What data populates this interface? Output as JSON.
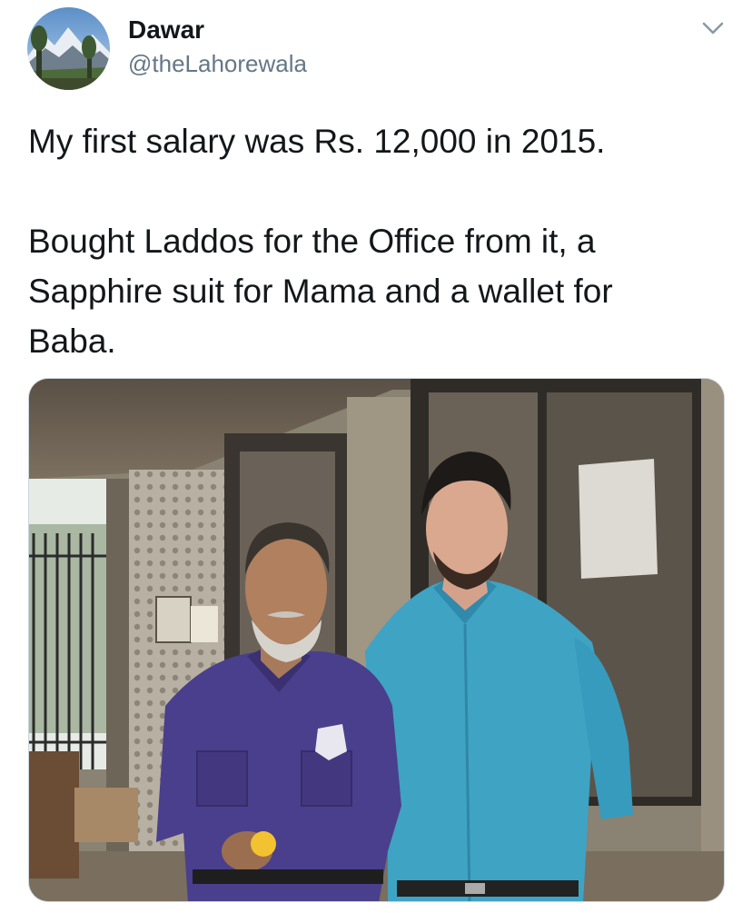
{
  "tweet": {
    "author": {
      "display_name": "Dawar",
      "handle": "@theLahorewala",
      "avatar": "mountain-landscape-avatar"
    },
    "menu_icon": "chevron-down-icon",
    "text_lines": [
      "My first salary was Rs. 12,000 in 2015.",
      "Bought Laddos for the Office from it, a",
      "Sapphire suit for Mama and a wallet for",
      "Baba."
    ],
    "media": {
      "type": "photo",
      "subject": "two-men-standing-in-front-of-office-building"
    }
  },
  "colors": {
    "text_primary": "#14171a",
    "text_secondary": "#657786",
    "border": "#ccd6dd",
    "guard_uniform": "#4a3f8c",
    "young_man_shirt": "#3fa3c4"
  }
}
